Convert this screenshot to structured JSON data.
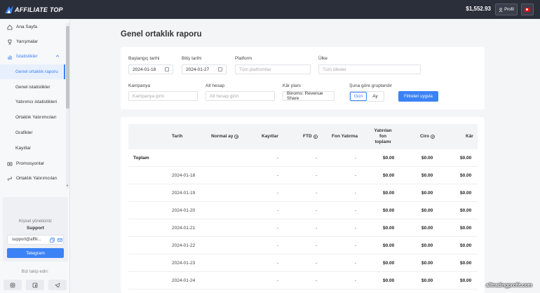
{
  "topbar": {
    "logo_text": "AFFILIATE TOP",
    "balance": "$1,552.93",
    "profile_label": "Profil",
    "colors": {
      "bar": "#2b2f3a",
      "accent": "#3b82f6"
    }
  },
  "sidebar": {
    "items": [
      {
        "label": "Ana Sayfa",
        "icon": "home-icon"
      },
      {
        "label": "Yarışmalar",
        "icon": "trophy-icon"
      },
      {
        "label": "İstatistikler",
        "icon": "chart-icon"
      },
      {
        "label": "Genel ortaklık raporu"
      },
      {
        "label": "Genel istatistikler"
      },
      {
        "label": "Yatırımcı istatistikleri"
      },
      {
        "label": "Ortaklık Yatırımcıları"
      },
      {
        "label": "Grafikler"
      },
      {
        "label": "Kayıtlar"
      },
      {
        "label": "Promosyonlar",
        "icon": "promo-icon"
      },
      {
        "label": "Ortaklık Yatırımcıları",
        "icon": "link-icon"
      }
    ],
    "support": {
      "title": "Kişisel yöneticiniz",
      "name": "Support",
      "email": "support@affili...",
      "telegram_label": "Telegram"
    },
    "follow_label": "Bizi takip edin:"
  },
  "page": {
    "title": "Genel ortaklık raporu"
  },
  "filters": {
    "start_date_label": "Başlangıç tarihi",
    "start_date": "2024-01-18",
    "end_date_label": "Bitiş tarihi",
    "end_date": "2024-01-27",
    "platform_label": "Platform",
    "platform_placeholder": "Tüm platformlar",
    "country_label": "Ülke",
    "country_placeholder": "Tüm ülkeler",
    "campaign_label": "Kampanya",
    "campaign_placeholder": "Kampanya girin",
    "subaccount_label": "Alt hesap",
    "subaccount_placeholder": "Alt hesap girin",
    "profit_plan_label": "Kâr planı",
    "profit_plan_value": "Binomo: Revenue Share",
    "group_by_label": "Şuna göre gruplandır",
    "group_day": "Gün",
    "group_month": "Ay",
    "group_selected": "Gün",
    "apply_label": "Filtreleri uygula"
  },
  "table": {
    "headers": {
      "date": "Tarih",
      "normal_month": "Normal ay",
      "registrations": "Kayıtlar",
      "ftd": "FTD",
      "fund_deposit": "Fon Yatırma",
      "total_deposits_l1": "Yatırılan fon",
      "total_deposits_l2": "toplamı",
      "revenue": "Ciro",
      "profit": "Kâr"
    },
    "total": {
      "label": "Toplam",
      "normal_month": "",
      "registrations": "-",
      "ftd": "-",
      "fund_deposit": "-",
      "total_deposits": "$0.00",
      "revenue": "$0.00",
      "profit": "$0.00"
    },
    "rows": [
      {
        "date": "2024-01-18",
        "registrations": "-",
        "ftd": "-",
        "fund_deposit": "-",
        "total_deposits": "$0.00",
        "revenue": "$0.00",
        "profit": "$0.00"
      },
      {
        "date": "2024-01-19",
        "registrations": "-",
        "ftd": "-",
        "fund_deposit": "-",
        "total_deposits": "$0.00",
        "revenue": "$0.00",
        "profit": "$0.00"
      },
      {
        "date": "2024-01-20",
        "registrations": "-",
        "ftd": "-",
        "fund_deposit": "-",
        "total_deposits": "$0.00",
        "revenue": "$0.00",
        "profit": "$0.00"
      },
      {
        "date": "2024-01-21",
        "registrations": "-",
        "ftd": "-",
        "fund_deposit": "-",
        "total_deposits": "$0.00",
        "revenue": "$0.00",
        "profit": "$0.00"
      },
      {
        "date": "2024-01-22",
        "registrations": "-",
        "ftd": "-",
        "fund_deposit": "-",
        "total_deposits": "$0.00",
        "revenue": "$0.00",
        "profit": "$0.00"
      },
      {
        "date": "2024-01-23",
        "registrations": "-",
        "ftd": "-",
        "fund_deposit": "-",
        "total_deposits": "$0.00",
        "revenue": "$0.00",
        "profit": "$0.00"
      },
      {
        "date": "2024-01-24",
        "registrations": "-",
        "ftd": "-",
        "fund_deposit": "-",
        "total_deposits": "$0.00",
        "revenue": "$0.00",
        "profit": "$0.00"
      }
    ]
  },
  "watermark": "alltradingprofit.com"
}
